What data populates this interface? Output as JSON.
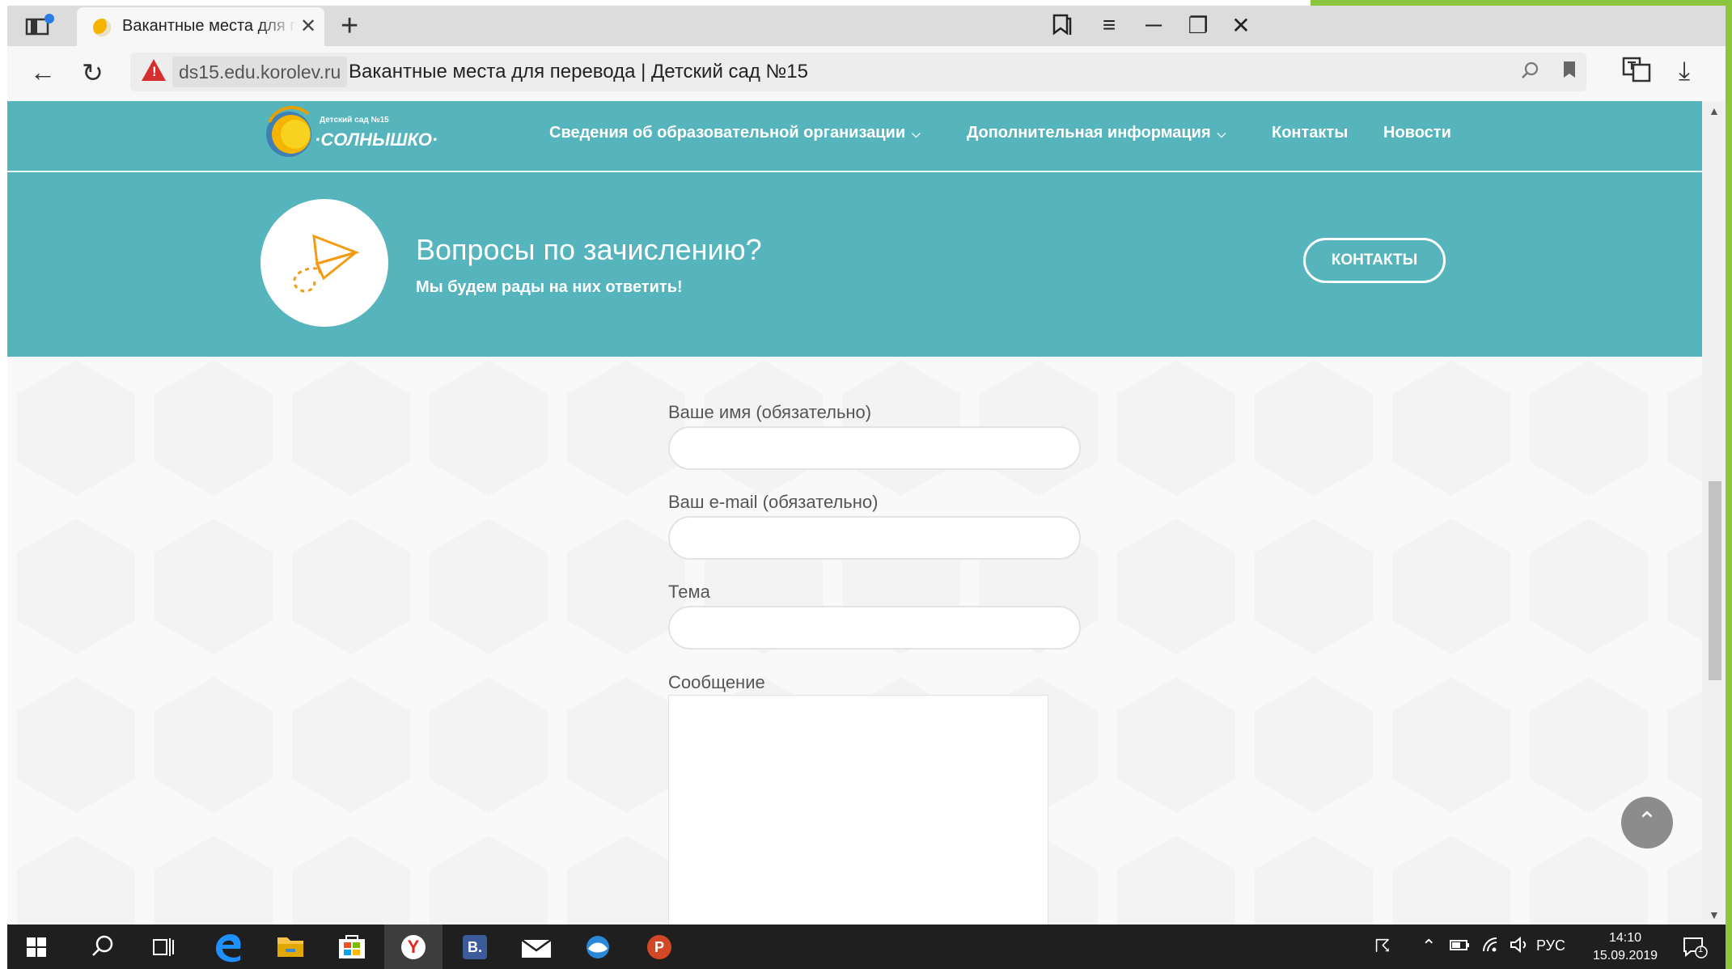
{
  "browser": {
    "tab": {
      "title": "Вакантные места для перевода | Детский сад №15",
      "close_glyph": "✕"
    },
    "new_tab_glyph": "+",
    "address": {
      "domain": "ds15.edu.korolev.ru",
      "title": "Вакантные места для перевода | Детский сад №15"
    },
    "glyphs": {
      "back": "←",
      "reload": "↻",
      "minimize": "─",
      "restore": "❐",
      "close": "✕",
      "menu": "≡",
      "download": "⤓"
    }
  },
  "site": {
    "logo": {
      "small": "Детский сад №15",
      "name": "·СОЛНЫШКО·"
    },
    "nav": [
      {
        "label": "Сведения об образовательной организации",
        "dropdown": true
      },
      {
        "label": "Дополнительная информация",
        "dropdown": true
      },
      {
        "label": "Контакты",
        "dropdown": false
      },
      {
        "label": "Новости",
        "dropdown": false
      }
    ],
    "banner": {
      "title": "Вопросы по зачислению?",
      "subtitle": "Мы будем рады на них ответить!",
      "button": "КОНТАКТЫ"
    },
    "form": {
      "name_label": "Ваше имя (обязательно)",
      "name_value": "",
      "email_label": "Ваш e-mail (обязательно)",
      "email_value": "",
      "subject_label": "Тема",
      "subject_value": "",
      "message_label": "Сообщение",
      "message_value": ""
    },
    "scroll_top_glyph": "⌃"
  },
  "taskbar": {
    "apps": [
      "start-icon",
      "search-icon",
      "task-view-icon",
      "edge-icon",
      "file-explorer-icon",
      "store-icon",
      "yandex-browser-icon",
      "vk-icon",
      "mail-icon",
      "app-icon",
      "powerpoint-icon"
    ],
    "yandex_letter": "Y",
    "vk_letter": "B.",
    "ppt_letter": "P",
    "language": "РУС",
    "time": "14:10",
    "date": "15.09.2019",
    "notification_count": "1"
  },
  "colors": {
    "teal": "#56b4bd",
    "accent_orange": "#f39c12",
    "slide_green": "#8cc63f"
  }
}
